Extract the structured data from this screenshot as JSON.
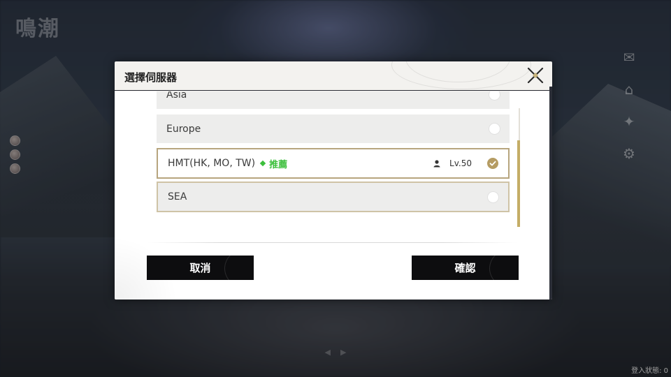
{
  "background": {
    "logo_text": "鳴潮",
    "login_status": "登入狀態: 0",
    "side_menu": [
      {
        "icon": "announcement-icon",
        "glyph": "✉"
      },
      {
        "icon": "store-icon",
        "glyph": "⌂"
      },
      {
        "icon": "character-icon",
        "glyph": "✦"
      },
      {
        "icon": "settings-icon",
        "glyph": "⚙"
      }
    ]
  },
  "dialog": {
    "title": "選擇伺服器",
    "close_icon": "close-icon",
    "servers": [
      {
        "name": "Asia",
        "selected": false,
        "recommended": false
      },
      {
        "name": "Europe",
        "selected": false,
        "recommended": false
      },
      {
        "name": "HMT(HK, MO, TW)",
        "selected": true,
        "recommended": true,
        "recommend_label": "推薦",
        "level": "Lv.50"
      },
      {
        "name": "SEA",
        "selected": false,
        "recommended": false
      }
    ],
    "cancel_label": "取消",
    "confirm_label": "確認"
  },
  "colors": {
    "accent_gold": "#b59c63",
    "recommend_green": "#3cbf3c",
    "button_bg": "#0d0d0f"
  }
}
